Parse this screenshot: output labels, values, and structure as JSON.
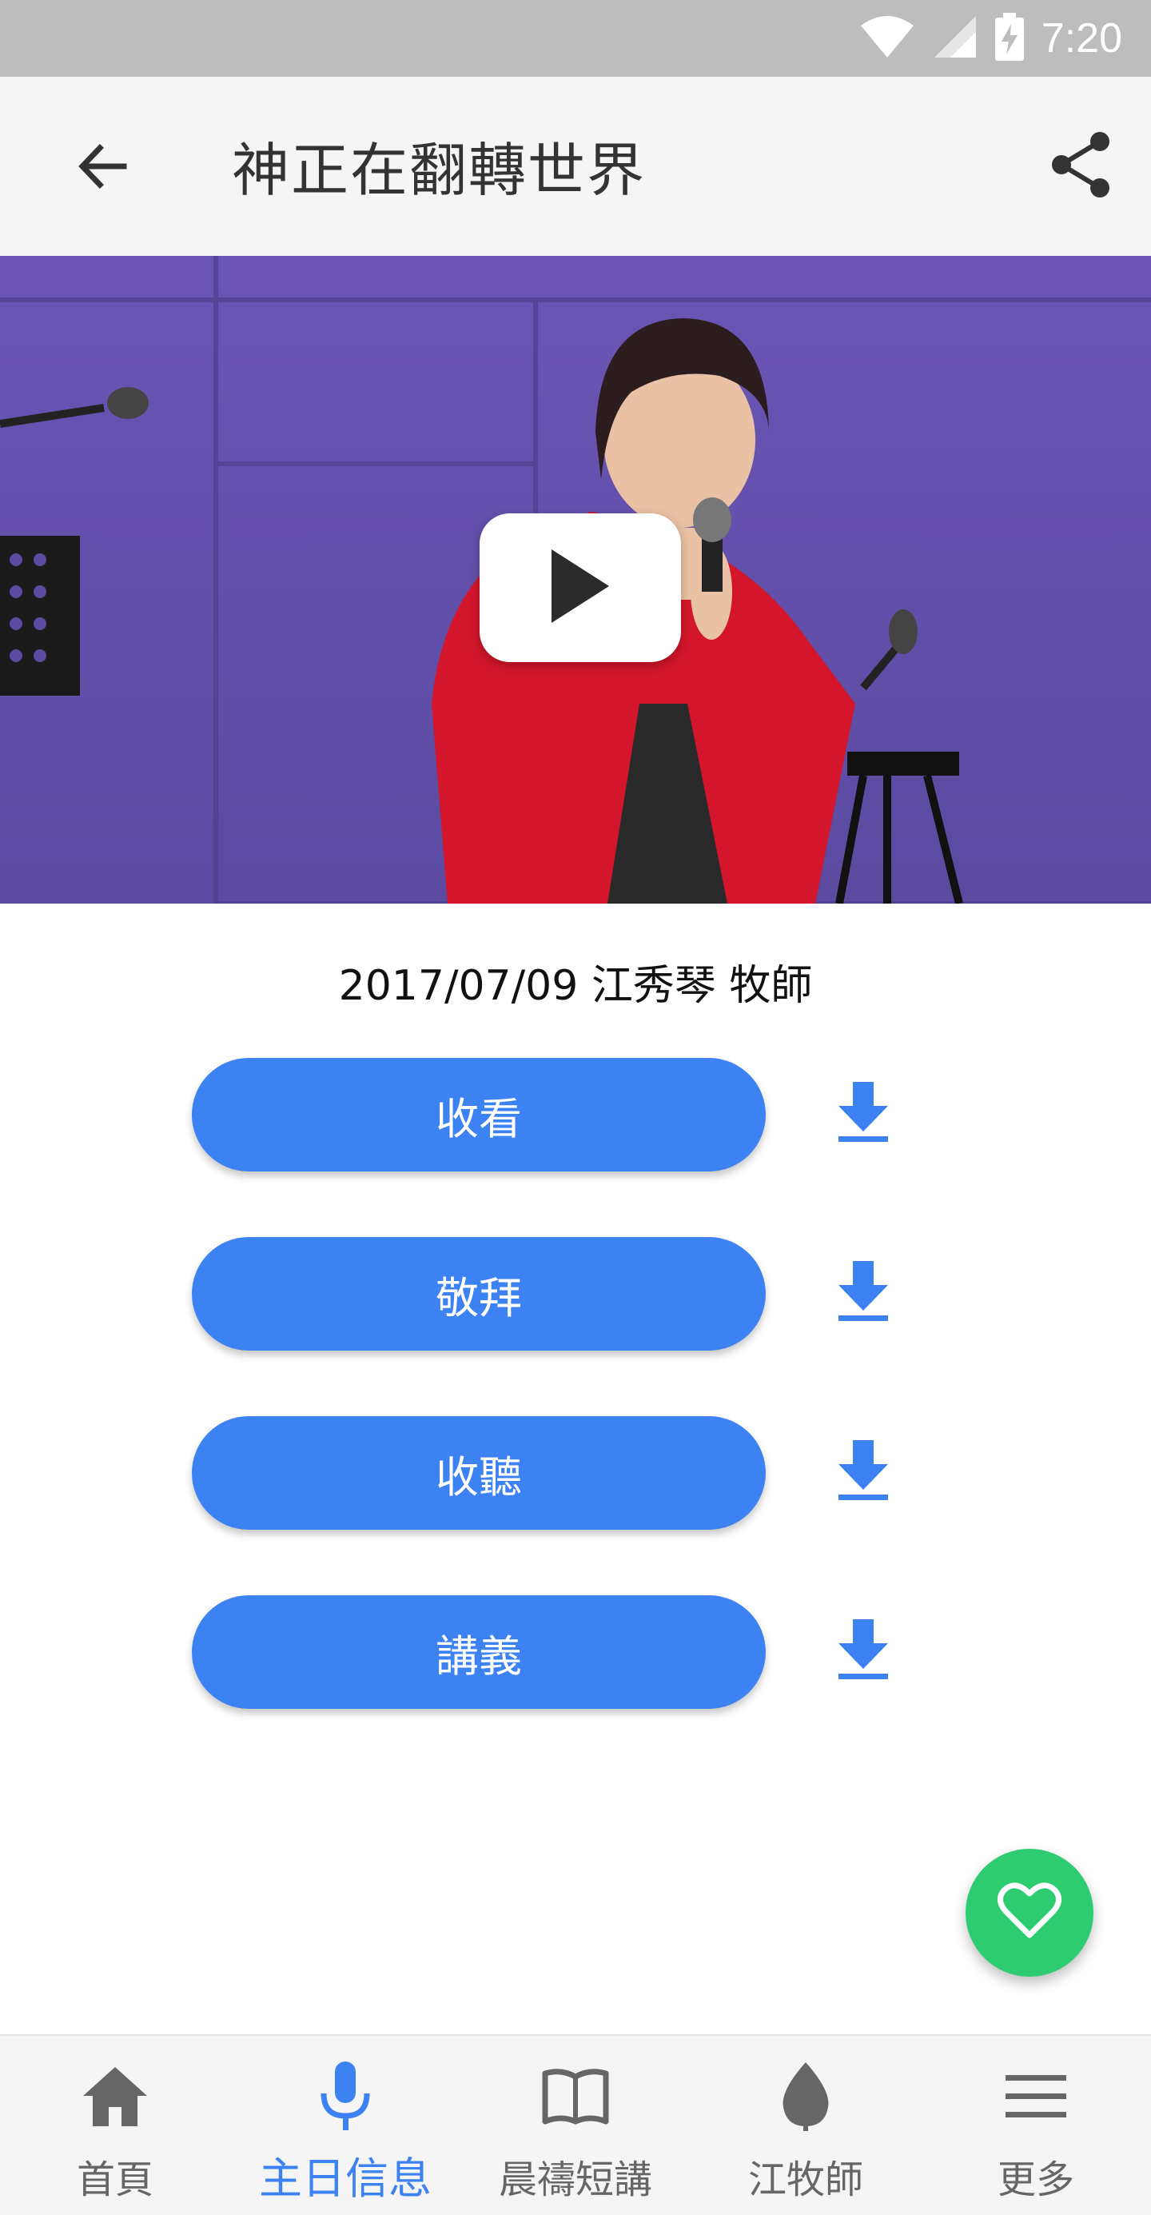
{
  "status_bar": {
    "time": "7:20",
    "icons": [
      "wifi-icon",
      "signal-icon",
      "battery-charging-icon"
    ]
  },
  "app_bar": {
    "title": "神正在翻轉世界",
    "back_icon": "arrow-back-icon",
    "share_icon": "share-icon"
  },
  "video": {
    "play_icon": "play-icon"
  },
  "sermon": {
    "meta": "2017/07/09 江秀琴 牧師"
  },
  "actions": [
    {
      "label": "收看",
      "download_icon": "download-icon"
    },
    {
      "label": "敬拜",
      "download_icon": "download-icon"
    },
    {
      "label": "收聽",
      "download_icon": "download-icon"
    },
    {
      "label": "講義",
      "download_icon": "download-icon"
    }
  ],
  "fab": {
    "icon": "heart-icon"
  },
  "bottom_nav": {
    "items": [
      {
        "label": "首頁",
        "icon": "home-icon",
        "active": false
      },
      {
        "label": "主日信息",
        "icon": "microphone-icon",
        "active": true
      },
      {
        "label": "晨禱短講",
        "icon": "book-icon",
        "active": false
      },
      {
        "label": "江牧師",
        "icon": "leaf-icon",
        "active": false
      },
      {
        "label": "更多",
        "icon": "menu-icon",
        "active": false
      }
    ]
  },
  "colors": {
    "accent": "#3d82f2",
    "fab": "#2ecc71",
    "status_bar": "#bdbdbd"
  }
}
